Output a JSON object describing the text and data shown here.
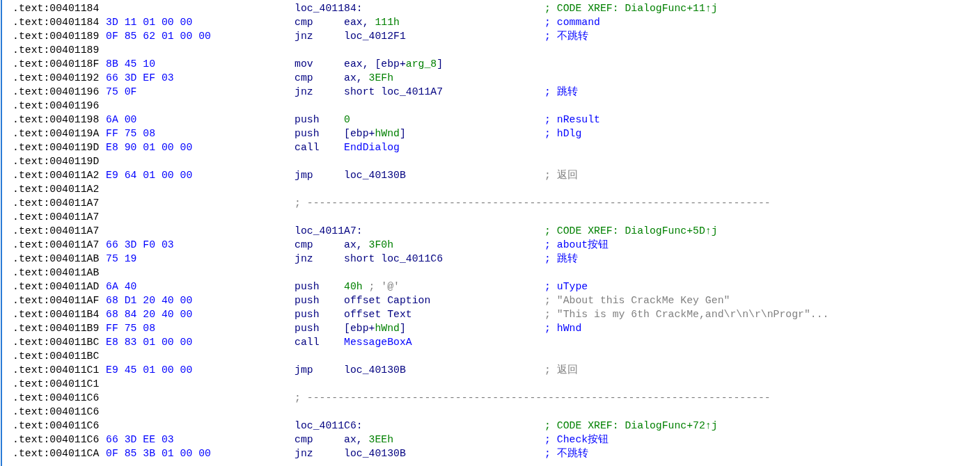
{
  "listing": {
    "rows": [
      {
        "kind": "label",
        "address": ".text:00401184",
        "label": "loc_401184:",
        "comment": {
          "text": "; CODE XREF: DialogFunc+11↑j",
          "kind": "xref"
        }
      },
      {
        "kind": "instr",
        "address": ".text:00401184",
        "bytes": "3D 11 01 00 00",
        "mnemonic": "cmp",
        "operands": [
          {
            "text": "eax, ",
            "kind": "plain"
          },
          {
            "text": "111h",
            "kind": "const"
          }
        ],
        "comment": {
          "text": "; command",
          "kind": "user"
        }
      },
      {
        "kind": "instr",
        "address": ".text:00401189",
        "bytes": "0F 85 62 01 00 00",
        "mnemonic": "jnz",
        "operands": [
          {
            "text": "loc_4012F1",
            "kind": "plain"
          }
        ],
        "comment": {
          "text": "; 不跳转",
          "kind": "user"
        }
      },
      {
        "kind": "blank",
        "address": ".text:00401189"
      },
      {
        "kind": "instr",
        "address": ".text:0040118F",
        "bytes": "8B 45 10",
        "mnemonic": "mov",
        "operands": [
          {
            "text": "eax, [ebp+",
            "kind": "plain"
          },
          {
            "text": "arg_8",
            "kind": "const"
          },
          {
            "text": "]",
            "kind": "plain"
          }
        ]
      },
      {
        "kind": "instr",
        "address": ".text:00401192",
        "bytes": "66 3D EF 03",
        "mnemonic": "cmp",
        "operands": [
          {
            "text": "ax, ",
            "kind": "plain"
          },
          {
            "text": "3EFh",
            "kind": "const"
          }
        ]
      },
      {
        "kind": "instr",
        "address": ".text:00401196",
        "bytes": "75 0F",
        "mnemonic": "jnz",
        "operands": [
          {
            "text": "short loc_4011A7",
            "kind": "plain"
          }
        ],
        "comment": {
          "text": "; 跳转",
          "kind": "user"
        }
      },
      {
        "kind": "blank",
        "address": ".text:00401196"
      },
      {
        "kind": "instr",
        "address": ".text:00401198",
        "bytes": "6A 00",
        "mnemonic": "push",
        "operands": [
          {
            "text": "0",
            "kind": "const"
          }
        ],
        "comment": {
          "text": "; nResult",
          "kind": "user"
        }
      },
      {
        "kind": "instr",
        "address": ".text:0040119A",
        "bytes": "FF 75 08",
        "mnemonic": "push",
        "operands": [
          {
            "text": "[ebp+",
            "kind": "plain"
          },
          {
            "text": "hWnd",
            "kind": "const"
          },
          {
            "text": "]",
            "kind": "plain"
          }
        ],
        "comment": {
          "text": "; hDlg",
          "kind": "user"
        }
      },
      {
        "kind": "instr",
        "address": ".text:0040119D",
        "bytes": "E8 90 01 00 00",
        "mnemonic": "call",
        "operands": [
          {
            "text": "EndDialog",
            "kind": "name"
          }
        ]
      },
      {
        "kind": "blank",
        "address": ".text:0040119D"
      },
      {
        "kind": "instr",
        "address": ".text:004011A2",
        "bytes": "E9 64 01 00 00",
        "mnemonic": "jmp",
        "operands": [
          {
            "text": "loc_40130B",
            "kind": "plain"
          }
        ],
        "comment": {
          "text": "; 返回",
          "kind": "auto"
        }
      },
      {
        "kind": "blank",
        "address": ".text:004011A2"
      },
      {
        "kind": "separator",
        "address": ".text:004011A7",
        "text": "; ---------------------------------------------------------------------------"
      },
      {
        "kind": "blank",
        "address": ".text:004011A7"
      },
      {
        "kind": "label",
        "address": ".text:004011A7",
        "label": "loc_4011A7:",
        "comment": {
          "text": "; CODE XREF: DialogFunc+5D↑j",
          "kind": "xref"
        }
      },
      {
        "kind": "instr",
        "address": ".text:004011A7",
        "bytes": "66 3D F0 03",
        "mnemonic": "cmp",
        "operands": [
          {
            "text": "ax, ",
            "kind": "plain"
          },
          {
            "text": "3F0h",
            "kind": "const"
          }
        ],
        "comment": {
          "text": "; about按钮",
          "kind": "user"
        }
      },
      {
        "kind": "instr",
        "address": ".text:004011AB",
        "bytes": "75 19",
        "mnemonic": "jnz",
        "operands": [
          {
            "text": "short loc_4011C6",
            "kind": "plain"
          }
        ],
        "comment": {
          "text": "; 跳转",
          "kind": "user"
        }
      },
      {
        "kind": "blank",
        "address": ".text:004011AB"
      },
      {
        "kind": "instr",
        "address": ".text:004011AD",
        "bytes": "6A 40",
        "mnemonic": "push",
        "operands": [
          {
            "text": "40h",
            "kind": "const"
          },
          {
            "text": " ; '@'",
            "kind": "comment"
          }
        ],
        "comment": {
          "text": "; uType",
          "kind": "user"
        }
      },
      {
        "kind": "instr",
        "address": ".text:004011AF",
        "bytes": "68 D1 20 40 00",
        "mnemonic": "push",
        "operands": [
          {
            "text": "offset Caption",
            "kind": "plain"
          }
        ],
        "comment": {
          "text": "; \"About this CrackMe Key Gen\"",
          "kind": "auto"
        }
      },
      {
        "kind": "instr",
        "address": ".text:004011B4",
        "bytes": "68 84 20 40 00",
        "mnemonic": "push",
        "operands": [
          {
            "text": "offset Text",
            "kind": "plain"
          }
        ],
        "comment": {
          "text": "; \"This is my 6th CrackMe,and\\r\\n\\r\\nProgr\"...",
          "kind": "auto"
        }
      },
      {
        "kind": "instr",
        "address": ".text:004011B9",
        "bytes": "FF 75 08",
        "mnemonic": "push",
        "operands": [
          {
            "text": "[ebp+",
            "kind": "plain"
          },
          {
            "text": "hWnd",
            "kind": "const"
          },
          {
            "text": "]",
            "kind": "plain"
          }
        ],
        "comment": {
          "text": "; hWnd",
          "kind": "user"
        }
      },
      {
        "kind": "instr",
        "address": ".text:004011BC",
        "bytes": "E8 83 01 00 00",
        "mnemonic": "call",
        "operands": [
          {
            "text": "MessageBoxA",
            "kind": "name"
          }
        ]
      },
      {
        "kind": "blank",
        "address": ".text:004011BC"
      },
      {
        "kind": "instr",
        "address": ".text:004011C1",
        "bytes": "E9 45 01 00 00",
        "mnemonic": "jmp",
        "operands": [
          {
            "text": "loc_40130B",
            "kind": "plain"
          }
        ],
        "comment": {
          "text": "; 返回",
          "kind": "auto"
        }
      },
      {
        "kind": "blank",
        "address": ".text:004011C1"
      },
      {
        "kind": "separator",
        "address": ".text:004011C6",
        "text": "; ---------------------------------------------------------------------------"
      },
      {
        "kind": "blank",
        "address": ".text:004011C6"
      },
      {
        "kind": "label",
        "address": ".text:004011C6",
        "label": "loc_4011C6:",
        "comment": {
          "text": "; CODE XREF: DialogFunc+72↑j",
          "kind": "xref"
        }
      },
      {
        "kind": "instr",
        "address": ".text:004011C6",
        "bytes": "66 3D EE 03",
        "mnemonic": "cmp",
        "operands": [
          {
            "text": "ax, ",
            "kind": "plain"
          },
          {
            "text": "3EEh",
            "kind": "const"
          }
        ],
        "comment": {
          "text": "; Check按钮",
          "kind": "user"
        }
      },
      {
        "kind": "instr",
        "address": ".text:004011CA",
        "bytes": "0F 85 3B 01 00 00",
        "mnemonic": "jnz",
        "operands": [
          {
            "text": "loc_40130B",
            "kind": "plain"
          }
        ],
        "comment": {
          "text": "; 不跳转",
          "kind": "user"
        }
      }
    ]
  }
}
